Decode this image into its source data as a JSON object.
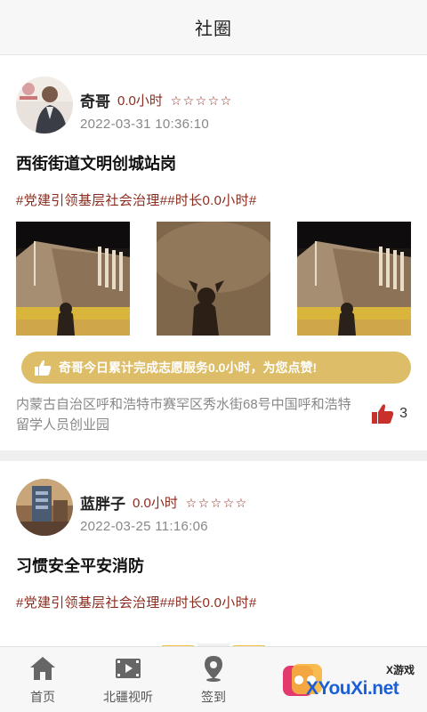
{
  "header": {
    "title": "社圈"
  },
  "posts": [
    {
      "user_name": "奇哥",
      "hours": "0.0小时",
      "stars": [
        "☆",
        "☆",
        "☆",
        "☆",
        "☆"
      ],
      "time": "2022-03-31 10:36:10",
      "title": "西街街道文明创城站岗",
      "tags": "#党建引领基层社会治理##时长0.0小时#",
      "cheer": "奇哥今日累计完成志愿服务0.0小时，为您点赞!",
      "location": "内蒙古自治区呼和浩特市赛罕区秀水街68号中国呼和浩特留学人员创业园",
      "likes": "3"
    },
    {
      "user_name": "蓝胖子",
      "hours": "0.0小时",
      "stars": [
        "☆",
        "☆",
        "☆",
        "☆",
        "☆"
      ],
      "time": "2022-03-25 11:16:06",
      "title": "习惯安全平安消防",
      "tags": "#党建引领基层社会治理##时长0.0小时#"
    }
  ],
  "tabbar": {
    "items": [
      {
        "label": "首页",
        "icon": "home-icon"
      },
      {
        "label": "北疆视听",
        "icon": "video-icon"
      },
      {
        "label": "签到",
        "icon": "location-pin-icon"
      }
    ]
  },
  "watermark": {
    "small": "X游戏",
    "big": "XYouXi.net"
  },
  "colors": {
    "accent": "#8b2c1f",
    "cheer_bg": "#ddbd67",
    "like": "#c9302c",
    "watermark": "#1a5fd6"
  }
}
